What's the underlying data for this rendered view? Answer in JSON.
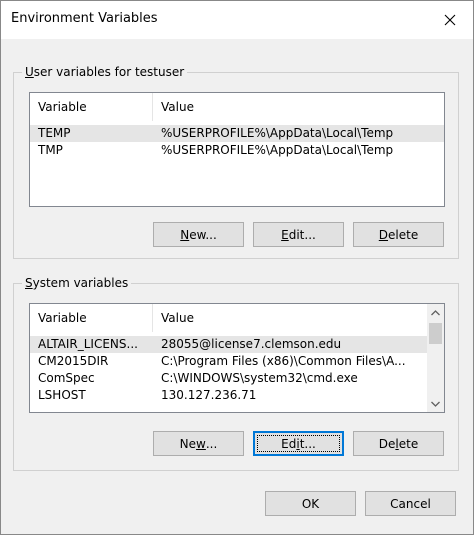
{
  "window": {
    "title": "Environment Variables"
  },
  "user_vars": {
    "group_label_prefix": "",
    "group_label_underline": "U",
    "group_label_rest": "ser variables for testuser",
    "columns": [
      "Variable",
      "Value"
    ],
    "rows": [
      {
        "variable": "TEMP",
        "value": "%USERPROFILE%\\AppData\\Local\\Temp",
        "selected": true
      },
      {
        "variable": "TMP",
        "value": "%USERPROFILE%\\AppData\\Local\\Temp",
        "selected": false
      }
    ],
    "buttons": {
      "new_pre": "",
      "new_u": "N",
      "new_post": "ew...",
      "edit_pre": "",
      "edit_u": "E",
      "edit_post": "dit...",
      "delete_pre": "",
      "delete_u": "D",
      "delete_post": "elete"
    }
  },
  "system_vars": {
    "group_label_prefix": "",
    "group_label_underline": "S",
    "group_label_rest": "ystem variables",
    "columns": [
      "Variable",
      "Value"
    ],
    "rows": [
      {
        "variable": "ALTAIR_LICENS...",
        "value": "28055@license7.clemson.edu",
        "selected": true
      },
      {
        "variable": "CM2015DIR",
        "value": "C:\\Program Files (x86)\\Common Files\\A...",
        "selected": false
      },
      {
        "variable": "ComSpec",
        "value": "C:\\WINDOWS\\system32\\cmd.exe",
        "selected": false
      },
      {
        "variable": "LSHOST",
        "value": "130.127.236.71",
        "selected": false
      }
    ],
    "buttons": {
      "new_pre": "Ne",
      "new_u": "w",
      "new_post": "...",
      "edit_pre": "Ed",
      "edit_u": "i",
      "edit_post": "t...",
      "delete_pre": "De",
      "delete_u": "l",
      "delete_post": "ete"
    }
  },
  "footer": {
    "ok_label": "OK",
    "cancel_label": "Cancel"
  },
  "icons": {
    "close": "close-icon",
    "up": "chevron-up-icon",
    "down": "chevron-down-icon"
  }
}
